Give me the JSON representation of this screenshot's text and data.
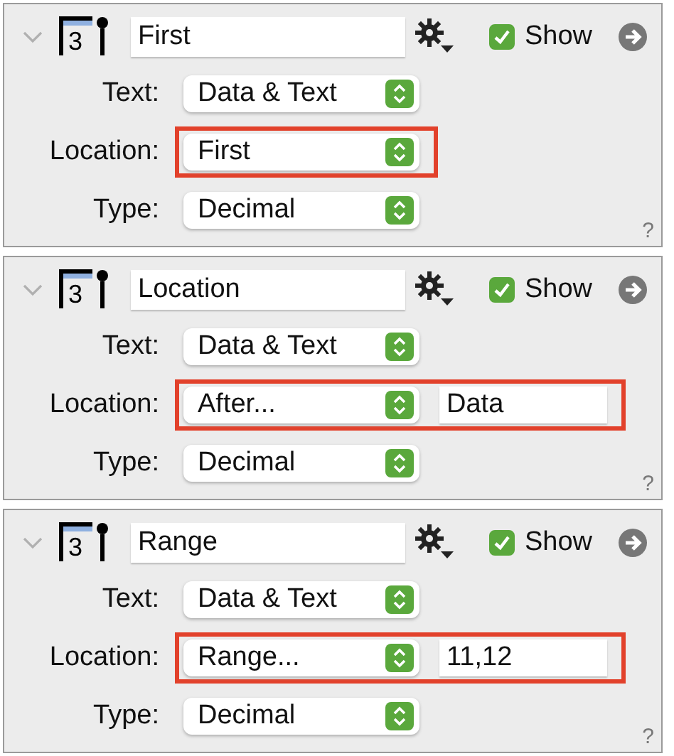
{
  "panels": [
    {
      "expanded": true,
      "icon_label": "3",
      "name": "First",
      "show_label": "Show",
      "show": true,
      "help": "?",
      "rows": [
        {
          "label": "Text:",
          "value": "Data & Text",
          "highlighted": false
        },
        {
          "label": "Location:",
          "value": "First",
          "highlighted": true
        },
        {
          "label": "Type:",
          "value": "Decimal",
          "highlighted": false
        }
      ]
    },
    {
      "expanded": true,
      "icon_label": "3",
      "name": "Location",
      "show_label": "Show",
      "show": true,
      "help": "?",
      "rows": [
        {
          "label": "Text:",
          "value": "Data & Text",
          "highlighted": false
        },
        {
          "label": "Location:",
          "value": "After...",
          "field": "Data",
          "highlighted": true
        },
        {
          "label": "Type:",
          "value": "Decimal",
          "highlighted": false
        }
      ]
    },
    {
      "expanded": true,
      "icon_label": "3",
      "name": "Range",
      "show_label": "Show",
      "show": true,
      "help": "?",
      "rows": [
        {
          "label": "Text:",
          "value": "Data & Text",
          "highlighted": false
        },
        {
          "label": "Location:",
          "value": "Range...",
          "field": "11,12",
          "highlighted": true
        },
        {
          "label": "Type:",
          "value": "Decimal",
          "highlighted": false
        }
      ]
    }
  ]
}
